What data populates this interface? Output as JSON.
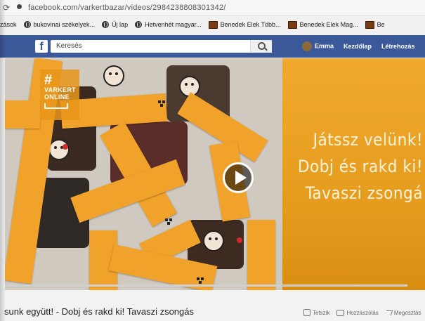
{
  "browser": {
    "url": "facebook.com/varkertbazar/videos/2984238808301342/",
    "bookmarks": [
      {
        "label": "zások",
        "icon": "apps-icon"
      },
      {
        "label": "bukovinai székelyek...",
        "icon": "globe-icon"
      },
      {
        "label": "Új lap",
        "icon": "globe-icon"
      },
      {
        "label": "Hetvenhét magyar...",
        "icon": "globe-icon"
      },
      {
        "label": "Benedek Elek Több...",
        "icon": "folder-icon"
      },
      {
        "label": "Benedek Elek Mag...",
        "icon": "folder-icon"
      },
      {
        "label": "Be",
        "icon": "folder-icon"
      }
    ]
  },
  "facebook": {
    "logo": "f",
    "search_placeholder": "Keresés",
    "user_name": "Emma",
    "nav_home": "Kezdőlap",
    "nav_create": "Létrehozás"
  },
  "video": {
    "badge_hash": "#",
    "badge_line1": "VARKERT",
    "badge_line2": "ONLINE",
    "promo_lines": [
      "Játssz velünk!",
      "Dobj és rakd ki!",
      "Tavaszi zsongá"
    ],
    "progress": 0
  },
  "post": {
    "caption": "sunk együtt! - Dobj és rakd ki! Tavaszi zsongás",
    "actions": [
      {
        "label": "Tetszik",
        "icon": "like-icon"
      },
      {
        "label": "Hozzászólás",
        "icon": "comment-icon"
      },
      {
        "label": "Megosztás",
        "icon": "share-icon"
      }
    ]
  },
  "colors": {
    "facebook_blue": "#3b5998",
    "promo_orange": "#f0a22a",
    "promo_text": "#fdf3dd"
  }
}
